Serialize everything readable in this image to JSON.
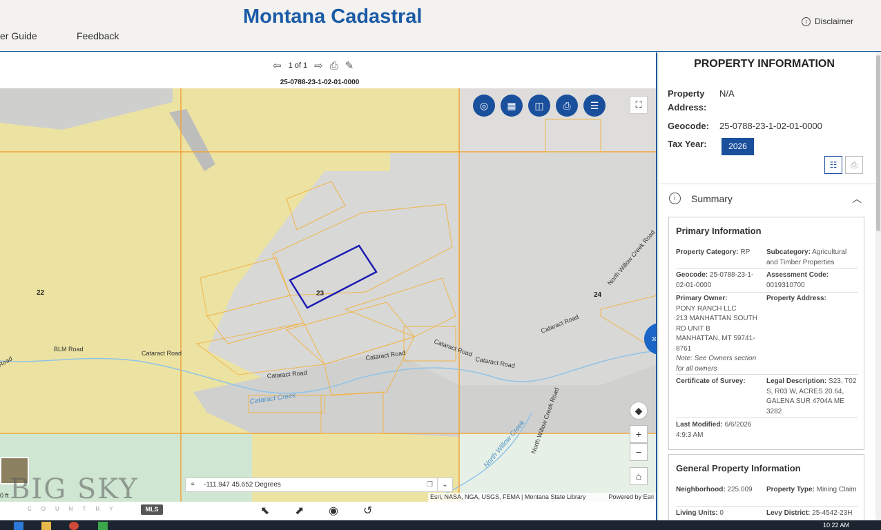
{
  "header": {
    "app_title": "Montana Cadastral",
    "nav_user_guide": "er Guide",
    "nav_feedback": "Feedback",
    "disclaimer": "Disclaimer"
  },
  "map": {
    "pager": "1 of 1",
    "geocode_label": "25-0788-23-1-02-01-0000",
    "section_labels": [
      "22",
      "23",
      "24"
    ],
    "road_labels": [
      "BLM Road",
      "Cataract Road",
      "Cataract Road",
      "Cataract Road",
      "Cataract Road",
      "Cataract Road",
      "Cataract Road",
      "Cataract Road",
      "North Willow Creek Road",
      "North Willow Creek Road",
      "Road"
    ],
    "water_labels": [
      "Cataract Creek",
      "North Willow Creek"
    ],
    "coordinates": "-111.947 45.652 Degrees",
    "attribution": "Esri, NASA, NGA, USGS, FEMA | Montana State Library",
    "powered_by": "Powered by Esri",
    "scale": "0 ft",
    "watermark": "BIG SKY",
    "watermark_sub": "COUNTRY",
    "watermark_mls": "MLS",
    "colors": {
      "public_land": "#ece3a2",
      "terrain": "#d9d9d9",
      "green_land": "#cfe6d2",
      "parcel_line": "#f0a43a",
      "selected_parcel": "#1b1bb4",
      "accent": "#1a4f9c"
    },
    "tool_icons": [
      "identify-icon",
      "basemap-icon",
      "compare-icon",
      "print-icon",
      "legend-icon"
    ]
  },
  "panel": {
    "title": "PROPERTY INFORMATION",
    "property_address_label": "Property Address:",
    "property_address_value": "N/A",
    "geocode_label": "Geocode:",
    "geocode_value": "25-0788-23-1-02-01-0000",
    "tax_year_label": "Tax Year:",
    "tax_year_value": "2026",
    "summary_label": "Summary",
    "primary_info": {
      "title": "Primary Information",
      "property_category_label": "Property Category:",
      "property_category_value": "RP",
      "subcategory_label": "Subcategory:",
      "subcategory_value": "Agricultural and Timber Properties",
      "geocode_label": "Geocode:",
      "geocode_value": "25-0788-23-1-02-01-0000",
      "assessment_code_label": "Assessment Code:",
      "assessment_code_value": "0019310700",
      "primary_owner_label": "Primary Owner:",
      "primary_owner_lines": [
        "PONY RANCH LLC",
        "213 MANHATTAN SOUTH",
        "RD UNIT B",
        "MANHATTAN, MT 59741-",
        "8761"
      ],
      "owner_note": "Note: See Owners section for all owners",
      "property_address_label": "Property Address:",
      "certificate_label": "Certificate of Survey:",
      "legal_label": "Legal Description:",
      "legal_value": "S23, T02 S, R03 W, ACRES 20.64, GALENA SUR 4704A ME 3282",
      "last_modified_label": "Last Modified:",
      "last_modified_value": "6/6/2026 4:9:3 AM"
    },
    "general_info": {
      "title": "General Property Information",
      "neighborhood_label": "Neighborhood:",
      "neighborhood_value": "225.009",
      "property_type_label": "Property Type:",
      "property_type_value": "Mining Claim",
      "living_units_label": "Living Units:",
      "living_units_value": "0",
      "levy_district_label": "Levy District:",
      "levy_district_value": "25-4542-23H"
    }
  },
  "taskbar": {
    "time": "10:22 AM"
  }
}
